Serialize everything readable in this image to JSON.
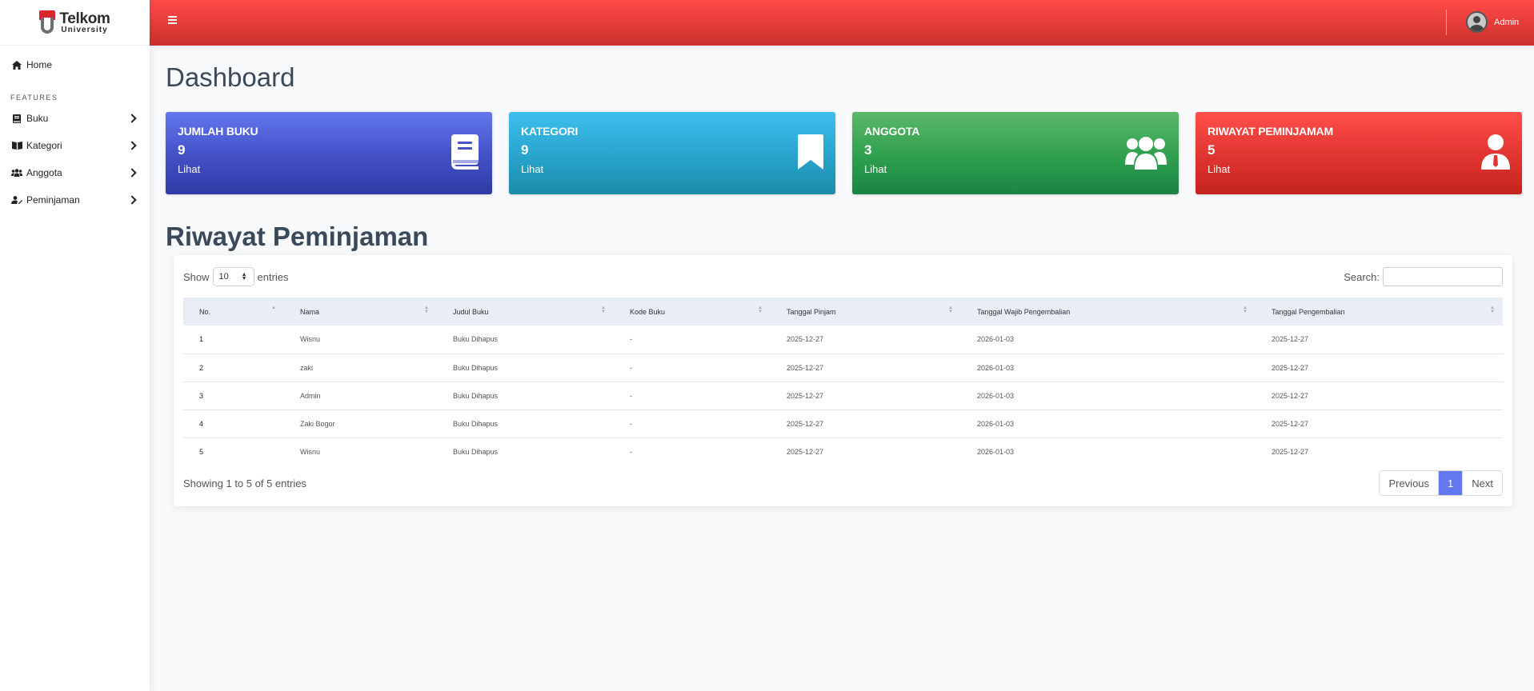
{
  "brand": {
    "name": "Telkom",
    "sub": "University"
  },
  "sidebar": {
    "home": {
      "label": "Home",
      "icon": "home-icon"
    },
    "heading": "FEATURES",
    "items": [
      {
        "label": "Buku",
        "icon": "book-icon"
      },
      {
        "label": "Kategori",
        "icon": "book-open-icon"
      },
      {
        "label": "Anggota",
        "icon": "users-icon"
      },
      {
        "label": "Peminjaman",
        "icon": "user-edit-icon"
      }
    ]
  },
  "topbar": {
    "user_name": "Admin"
  },
  "page": {
    "title": "Dashboard",
    "section_title": "Riwayat Peminjaman"
  },
  "cards": [
    {
      "title": "JUMLAH BUKU",
      "count": "9",
      "link": "Lihat",
      "color": "#4553c9",
      "icon": "book-icon"
    },
    {
      "title": "KATEGORI",
      "count": "9",
      "link": "Lihat",
      "color": "#28a3cc",
      "icon": "bookmark-icon"
    },
    {
      "title": "ANGGOTA",
      "count": "3",
      "link": "Lihat",
      "color": "#2e9f4d",
      "icon": "users-icon"
    },
    {
      "title": "RIWAYAT PEMINJAMAM",
      "count": "5",
      "link": "Lihat",
      "color": "#e0342f",
      "icon": "user-tie-icon"
    }
  ],
  "table_controls": {
    "show_label": "Show",
    "entries_value": "10",
    "entries_label": "entries",
    "search_label": "Search:"
  },
  "table": {
    "headers": [
      "No.",
      "Nama",
      "Judul Buku",
      "Kode Buku",
      "Tanggal Pinjam",
      "Tanggal Wajib Pengembalian",
      "Tanggal Pengembalian"
    ],
    "rows": [
      [
        "1",
        "Wisnu",
        "Buku Dihapus",
        "-",
        "2025-12-27",
        "2026-01-03",
        "2025-12-27"
      ],
      [
        "2",
        "zaki",
        "Buku Dihapus",
        "-",
        "2025-12-27",
        "2026-01-03",
        "2025-12-27"
      ],
      [
        "3",
        "Admin",
        "Buku Dihapus",
        "-",
        "2025-12-27",
        "2026-01-03",
        "2025-12-27"
      ],
      [
        "4",
        "Zaki Bogor",
        "Buku Dihapus",
        "-",
        "2025-12-27",
        "2026-01-03",
        "2025-12-27"
      ],
      [
        "5",
        "Wisnu",
        "Buku Dihapus",
        "-",
        "2025-12-27",
        "2026-01-03",
        "2025-12-27"
      ]
    ]
  },
  "pagination": {
    "info": "Showing 1 to 5 of 5 entries",
    "previous": "Previous",
    "current": "1",
    "next": "Next"
  },
  "colors": {
    "topbar": "#e13a36",
    "accent": "#6377ee"
  }
}
